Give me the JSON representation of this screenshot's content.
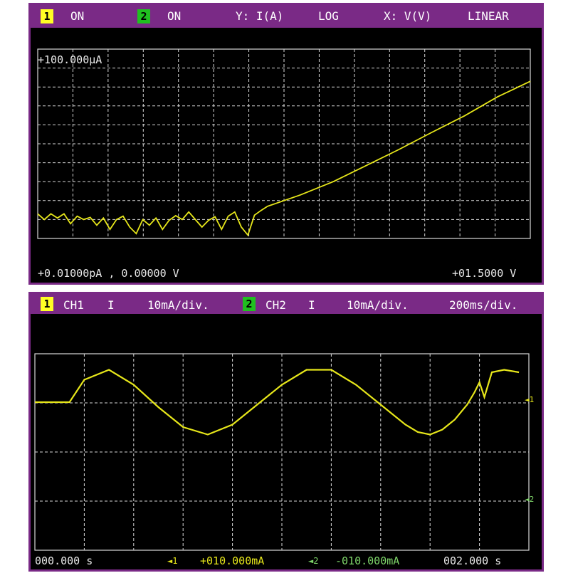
{
  "top_panel": {
    "header": {
      "ch1_num": "1",
      "ch1_state": "ON",
      "ch2_num": "2",
      "ch2_state": "ON",
      "y_label": "Y: I(A)",
      "y_scale": "LOG",
      "x_label": "X: V(V)",
      "x_scale": "LINEAR"
    },
    "y_top": "+100.000µA",
    "bottom_left": "+0.01000pA , 0.00000 V",
    "bottom_right": "+01.5000 V"
  },
  "bottom_panel": {
    "header": {
      "ch1_num": "1",
      "ch1_label": "CH1",
      "ch1_meas": "I",
      "ch1_scale": "10mA/div.",
      "ch2_num": "2",
      "ch2_label": "CH2",
      "ch2_meas": "I",
      "ch2_scale": "10mA/div.",
      "time_scale": "200ms/div."
    },
    "marker1": "◄1",
    "marker2": "◄2",
    "footer": {
      "t_start": "000.000 s",
      "ch1_marker": "◄1",
      "ch1_offset": "+010.000mA",
      "ch2_marker": "◄2",
      "ch2_offset": "-010.000mA",
      "t_end": "002.000 s"
    }
  },
  "colors": {
    "frame": "#7a2a86",
    "trace": "#e6e61a",
    "grid": "#d8d8d8",
    "ch1": "#ffff24",
    "ch2": "#20c020"
  },
  "chart_data": [
    {
      "type": "line",
      "xlabel": "V(V)",
      "ylabel": "I(A)",
      "y_scale": "log",
      "x_scale": "linear",
      "xlim": [
        0.0,
        1.5
      ],
      "ylim": [
        1e-14,
        0.0001
      ],
      "grid": true,
      "series": [
        {
          "x": [
            0,
            0.02,
            0.04,
            0.06,
            0.08,
            0.1,
            0.12,
            0.14,
            0.16,
            0.18,
            0.2,
            0.22,
            0.24,
            0.26,
            0.28,
            0.3,
            0.32,
            0.34,
            0.36,
            0.38,
            0.4,
            0.42,
            0.44,
            0.46,
            0.48,
            0.5,
            0.52,
            0.54,
            0.56,
            0.58,
            0.6,
            0.62,
            0.64,
            0.66,
            0.68,
            0.7,
            0.8,
            0.9,
            1.0,
            1.1,
            1.2,
            1.3,
            1.4,
            1.5
          ],
          "y": [
            2e-13,
            1e-13,
            2e-13,
            1.2e-13,
            2e-13,
            6e-14,
            1.5e-13,
            1e-13,
            1.3e-13,
            5e-14,
            1.2e-13,
            3e-14,
            1e-13,
            1.5e-13,
            4e-14,
            1.8e-14,
            1e-13,
            5e-14,
            1.2e-13,
            3e-14,
            9e-14,
            1.6e-13,
            1e-13,
            2.5e-13,
            1e-13,
            4e-14,
            9e-14,
            1.4e-13,
            3e-14,
            1.5e-13,
            2.5e-13,
            4e-14,
            1.5e-14,
            1.7e-13,
            3e-13,
            5e-13,
            2e-12,
            1e-11,
            7e-11,
            5e-10,
            4e-09,
            3e-08,
            3e-07,
            2e-06
          ]
        }
      ]
    },
    {
      "type": "line",
      "xlabel": "s",
      "ylabel": "mA",
      "xlim": [
        0.0,
        2.0
      ],
      "grid": true,
      "series": [
        {
          "x": [
            0,
            0.1,
            0.14,
            0.2,
            0.3,
            0.4,
            0.5,
            0.6,
            0.7,
            0.8,
            0.9,
            1.0,
            1.1,
            1.2,
            1.3,
            1.4,
            1.5,
            1.55,
            1.6,
            1.65,
            1.7,
            1.75,
            1.78,
            1.8,
            1.82,
            1.85,
            1.9,
            1.96
          ],
          "y": [
            0,
            0,
            0,
            4.5,
            6.5,
            3.5,
            -1.0,
            -5.0,
            -6.5,
            -4.5,
            -0.5,
            3.5,
            6.5,
            6.5,
            3.5,
            -0.5,
            -4.5,
            -6.0,
            -6.5,
            -5.5,
            -3.5,
            -0.5,
            2.0,
            4.0,
            1.0,
            6.0,
            6.5,
            6.0
          ]
        }
      ]
    }
  ]
}
